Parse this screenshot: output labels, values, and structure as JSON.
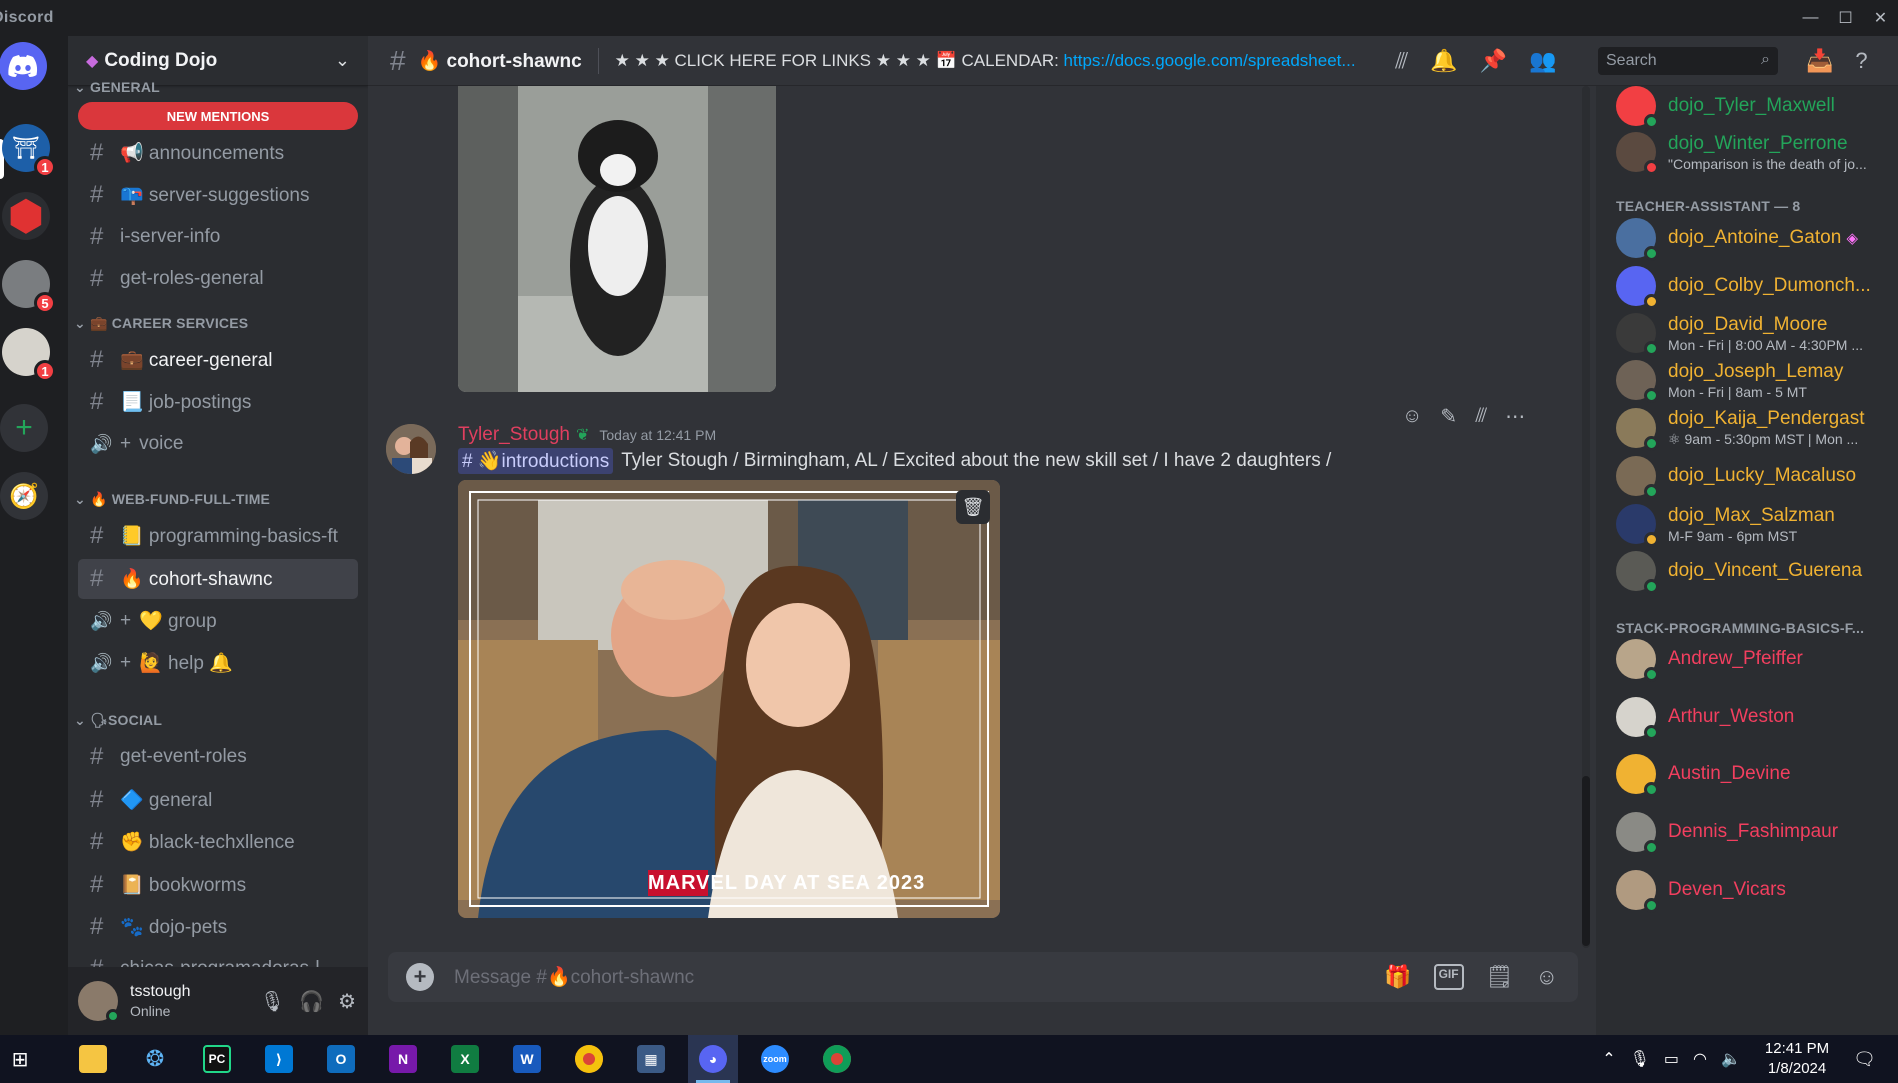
{
  "window": {
    "app_name": "Discord",
    "controls": [
      "minimize-icon",
      "maximize-icon",
      "close-icon"
    ]
  },
  "servers": [
    {
      "name": "home",
      "badge": ""
    },
    {
      "name": "coding-dojo",
      "badge": "1"
    },
    {
      "name": "d20-server",
      "badge": ""
    },
    {
      "name": "ship-server",
      "badge": "5"
    },
    {
      "name": "astronaut-server",
      "badge": "1"
    }
  ],
  "guild": {
    "name": "Coding Dojo"
  },
  "sidebar": {
    "new_mentions": "NEW MENTIONS",
    "categories": {
      "general": "GENERAL",
      "career": "CAREER SERVICES",
      "webfund": "WEB-FUND-FULL-TIME",
      "social": "SOCIAL"
    },
    "channels": {
      "announcements": "📢 announcements",
      "server_suggestions": "📪 server-suggestions",
      "server_info": "i-server-info",
      "get_roles": "get-roles-general",
      "career_general": "💼 career-general",
      "job_postings": "📃 job-postings",
      "voice": "voice",
      "programming_basics": "📒 programming-basics-ft",
      "cohort": "🔥 cohort-shawnc",
      "group": "💛 group",
      "help": "🙋 help 🔔",
      "get_event_roles": "get-event-roles",
      "general": "🔷 general",
      "black_tech": "✊ black-techxllence",
      "bookworms": "📔 bookworms",
      "dojo_pets": "🐾 dojo-pets",
      "chicago": "chicas-programadoras-l"
    }
  },
  "user": {
    "name": "tsstough",
    "status": "Online"
  },
  "header": {
    "channel": "🔥 cohort-shawnc",
    "topic_prefix": "★ ★ ★ CLICK HERE FOR LINKS ★ ★ ★ 📅 CALENDAR: ",
    "topic_link": "https://docs.google.com/spreadsheet...",
    "search_placeholder": "Search"
  },
  "message": {
    "author": "Tyler_Stough",
    "timestamp": "Today at 12:41 PM",
    "mention": "# 👋introductions",
    "text": "Tyler Stough / Birmingham, AL / Excited about the new skill set / I have 2 daughters /",
    "photo_caption": "MARVEL DAY AT SEA 2023"
  },
  "composer": {
    "placeholder": "Message #🔥cohort-shawnc",
    "gif": "GIF"
  },
  "members": {
    "top": [
      {
        "name": "dojo_Tyler_Maxwell",
        "status": "",
        "color": "#23a55a"
      },
      {
        "name": "dojo_Winter_Perrone",
        "status": "\"Comparison is the death of jo...",
        "color": "#23a55a"
      }
    ],
    "ta_header": "TEACHER-ASSISTANT — 8",
    "tas": [
      {
        "name": "dojo_Antoine_Gaton",
        "status": ""
      },
      {
        "name": "dojo_Colby_Dumonch...",
        "status": ""
      },
      {
        "name": "dojo_David_Moore",
        "status": "Mon - Fri | 8:00 AM - 4:30PM ..."
      },
      {
        "name": "dojo_Joseph_Lemay",
        "status": "Mon - Fri | 8am - 5 MT"
      },
      {
        "name": "dojo_Kaija_Pendergast",
        "status": "⚛ 9am - 5:30pm MST | Mon ..."
      },
      {
        "name": "dojo_Lucky_Macaluso",
        "status": ""
      },
      {
        "name": "dojo_Max_Salzman",
        "status": "M-F 9am - 6pm MST"
      },
      {
        "name": "dojo_Vincent_Guerena",
        "status": ""
      }
    ],
    "stack_header": "STACK-PROGRAMMING-BASICS-F...",
    "stack": [
      {
        "name": "Andrew_Pfeiffer"
      },
      {
        "name": "Arthur_Weston"
      },
      {
        "name": "Austin_Devine"
      },
      {
        "name": "Dennis_Fashimpaur"
      },
      {
        "name": "Deven_Vicars"
      }
    ]
  },
  "taskbar": {
    "apps": [
      "File Explorer",
      "Network",
      "PyCharm",
      "VS Code",
      "Outlook",
      "OneNote",
      "Excel",
      "Word",
      "Chrome",
      "Calculator",
      "Discord",
      "Zoom",
      "Chrome Profile"
    ],
    "time": "12:41 PM",
    "date": "1/8/2024"
  },
  "colors": {
    "ta_name": "#f0b232",
    "stack_name": "#f23f5f",
    "author": "#e03f5f",
    "link": "#00a8fc"
  }
}
